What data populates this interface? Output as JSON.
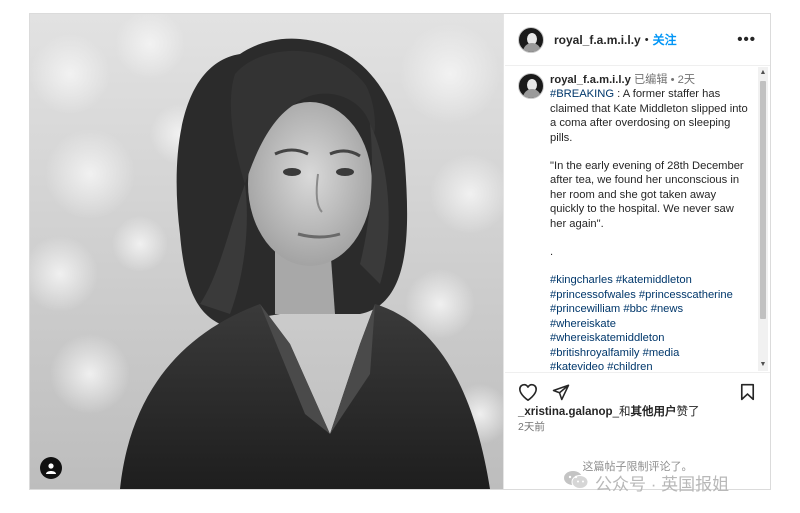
{
  "post": {
    "username": "royal_f.a.m.i.l.y",
    "dot": "•",
    "follow_label": "关注",
    "more_label": "•••"
  },
  "caption": {
    "username": "royal_f.a.m.i.l.y",
    "edited": "已编辑",
    "separator": "•",
    "age": "2天",
    "hashtag": "#BREAKING",
    "lead": " : A former staffer has claimed that Kate Middleton slipped into a coma after overdosing on sleeping pills.",
    "quote": "\"In the early evening of 28th December after tea, we found her unconscious in her room and she got taken away quickly to the hospital. We never saw her again\".",
    "dot_line": ".",
    "tags": [
      "#kingcharles #katemiddleton",
      "#princessofwales #princesscatherine",
      "#princewilliam #bbc #news",
      "#whereiskate",
      "#whereiskatemiddleton",
      "#britishroyalfamily #media",
      "#katevideo #children"
    ]
  },
  "icons": {
    "heart": "heart-icon",
    "share": "send-icon",
    "save": "bookmark-icon",
    "user_tag": "user-icon"
  },
  "likes": {
    "user": "_xristina.galanop",
    "middle": "_和",
    "others": "其他用户",
    "suffix": "赞了"
  },
  "timestamp": "2天前",
  "comments_notice": "这篇帖子限制评论了。",
  "watermark": {
    "text": "公众号 · 英国报姐"
  }
}
